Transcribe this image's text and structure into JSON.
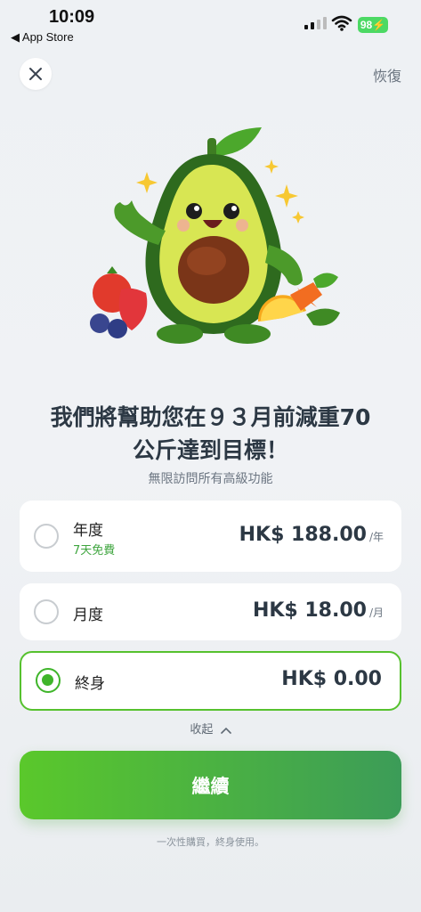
{
  "status_bar": {
    "time": "10:09",
    "back_label": "◀ App Store",
    "battery": "98"
  },
  "header": {
    "restore_label": "恢復"
  },
  "hero": {
    "headline_line1": "我們將幫助您在９３月前減重70",
    "headline_line2": "公斤達到目標！",
    "subtitle": "無限訪問所有高級功能"
  },
  "plans": [
    {
      "name": "年度",
      "trial": "7天免費",
      "price": "HK$ 188.00",
      "period": "/年",
      "selected": false
    },
    {
      "name": "月度",
      "price": "HK$ 18.00",
      "period": "/月",
      "selected": false
    },
    {
      "name": "終身",
      "price": "HK$ 0.00",
      "selected": true
    }
  ],
  "collapse_label": "收起",
  "cta_label": "繼續",
  "footnote": "一次性購買，終身使用。",
  "colors": {
    "accent": "#56c12e",
    "cta_end": "#3c9c58"
  }
}
